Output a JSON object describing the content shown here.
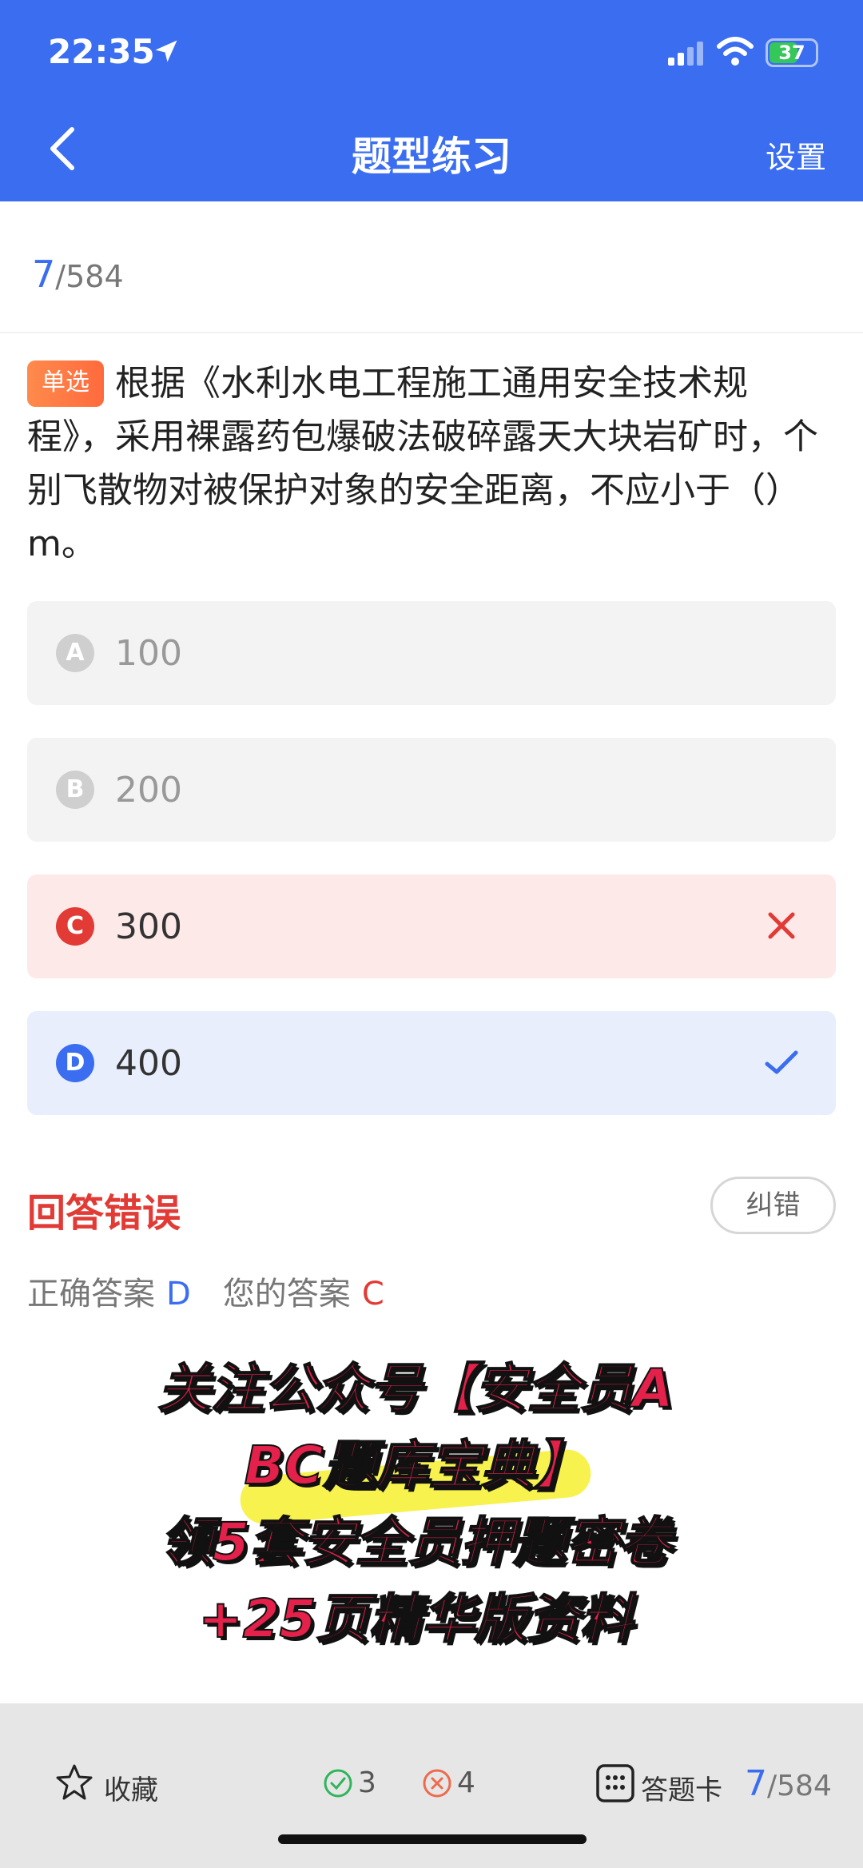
{
  "status": {
    "time": "22:35",
    "battery": "37"
  },
  "nav": {
    "title": "题型练习",
    "settings": "设置"
  },
  "progress": {
    "current": "7",
    "total": "/584"
  },
  "question": {
    "type": "单选",
    "text": "根据《水利水电工程施工通用安全技术规程》，采用裸露药包爆破法破碎露天大块岩矿时，个别飞散物对被保护对象的安全距离，不应小于（）m。"
  },
  "options": [
    {
      "letter": "A",
      "text": "100"
    },
    {
      "letter": "B",
      "text": "200"
    },
    {
      "letter": "C",
      "text": "300"
    },
    {
      "letter": "D",
      "text": "400"
    }
  ],
  "result": {
    "title": "回答错误",
    "report": "纠错",
    "correct_label": "正确答案",
    "correct_value": "D",
    "mine_label": "您的答案",
    "mine_value": "C"
  },
  "promo": {
    "line1": "关注公众号【安全员A",
    "line2": "BC题库宝典】",
    "line3": "领5套安全员押题密卷",
    "line4": "+25页精华版资料"
  },
  "bottom": {
    "favorite": "收藏",
    "correct_count": "3",
    "wrong_count": "4",
    "answer_card": "答题卡",
    "current": "7",
    "total": "/584"
  },
  "colors": {
    "accent": "#3a6df0",
    "error": "#e23a35",
    "success": "#2fb55b"
  },
  "icons": [
    "back-icon",
    "location-icon",
    "signal-icon",
    "wifi-icon",
    "battery-icon",
    "wrong-icon",
    "check-icon",
    "star-icon",
    "correct-count-icon",
    "wrong-count-icon",
    "answer-card-icon"
  ]
}
